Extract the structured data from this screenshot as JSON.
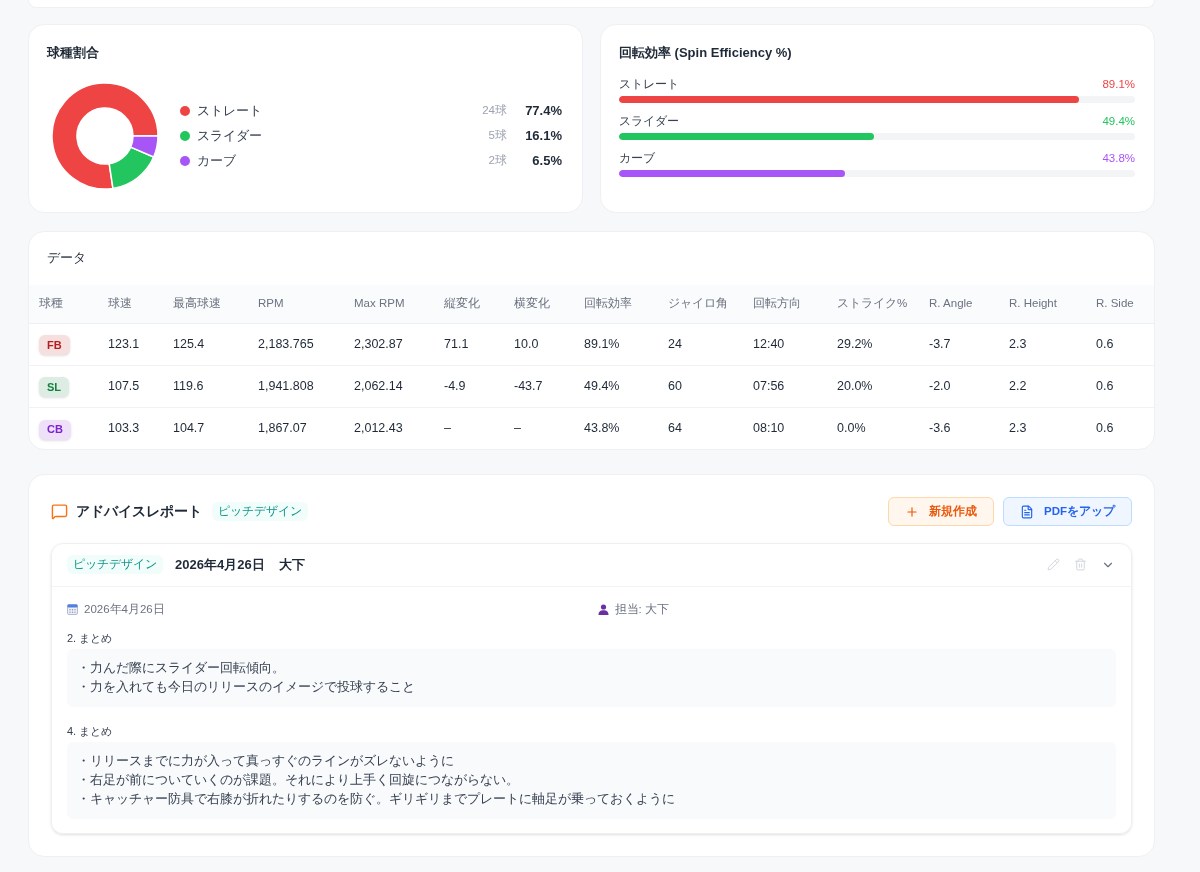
{
  "pitch_share": {
    "title": "球種割合",
    "chart_data": {
      "type": "donut",
      "categories": [
        "ストレート",
        "スライダー",
        "カーブ"
      ],
      "values": [
        77.4,
        16.1,
        6.5
      ]
    },
    "legend": [
      {
        "count": "24球",
        "percent": "77.4%",
        "color": "#ef4444"
      },
      {
        "count": "5球",
        "percent": "16.1%",
        "color": "#22c55e"
      },
      {
        "count": "2球",
        "percent": "6.5%",
        "color": "#a855f7"
      }
    ]
  },
  "spin_efficiency": {
    "title": "回転効率 (Spin Efficiency %)",
    "bars": [
      {
        "label": "ストレート",
        "level": 0.891,
        "reading": "89.1%",
        "color": "#ef4444"
      },
      {
        "label": "スライダー",
        "level": 0.494,
        "reading": "49.4%",
        "color": "#22c55e"
      },
      {
        "label": "カーブ",
        "level": 0.438,
        "reading": "43.8%",
        "color": "#a855f7"
      }
    ]
  },
  "data_table": {
    "title": "データ",
    "columns": [
      "球種",
      "球速",
      "最高球速",
      "RPM",
      "Max RPM",
      "縦変化",
      "横変化",
      "回転効率",
      "ジャイロ角",
      "回転方向",
      "ストライク%",
      "R. Angle",
      "R. Height",
      "R. Side"
    ],
    "rows": [
      {
        "color": "#b91c1c",
        "cells": [
          "FB",
          "123.1",
          "125.4",
          "2,183.765",
          "2,302.87",
          "71.1",
          "10.0",
          "89.1%",
          "24",
          "12:40",
          "29.2%",
          "-3.7",
          "2.3",
          "0.6"
        ]
      },
      {
        "color": "#15803d",
        "cells": [
          "SL",
          "107.5",
          "119.6",
          "1,941.808",
          "2,062.14",
          "-4.9",
          "-43.7",
          "49.4%",
          "60",
          "07:56",
          "20.0%",
          "-2.0",
          "2.2",
          "0.6"
        ]
      },
      {
        "color": "#7e22ce",
        "cells": [
          "CB",
          "103.3",
          "104.7",
          "1,867.07",
          "2,012.43",
          "–",
          "–",
          "43.8%",
          "64",
          "08:10",
          "0.0%",
          "-3.6",
          "2.3",
          "0.6"
        ]
      }
    ]
  },
  "advice_report": {
    "title": "アドバイスレポート",
    "tag": "ピッチデザイン",
    "buttons": [
      {
        "label": "新規作成",
        "kind": "create"
      },
      {
        "label": "PDFをアップ",
        "kind": "upload"
      }
    ],
    "reports": [
      {
        "tag": "ピッチデザイン",
        "title_date": "2026年4月26日",
        "title_author": "大下",
        "date": "2026年4月26日",
        "assignee": "担当: 大下",
        "sections": [
          {
            "heading": "2. まとめ",
            "lines": [
              "・力んだ際にスライダー回転傾向。",
              "・力を入れても今日のリリースのイメージで投球すること"
            ]
          },
          {
            "heading": "4. まとめ",
            "lines": [
              "・リリースまでに力が入って真っすぐのラインがズレないように",
              "・右足が前についていくのが課題。それにより上手く回旋につながらない。",
              "・キャッチャー防具で右膝が折れたりするのを防ぐ。ギリギリまでプレートに軸足が乗っておくように"
            ]
          }
        ]
      }
    ]
  }
}
